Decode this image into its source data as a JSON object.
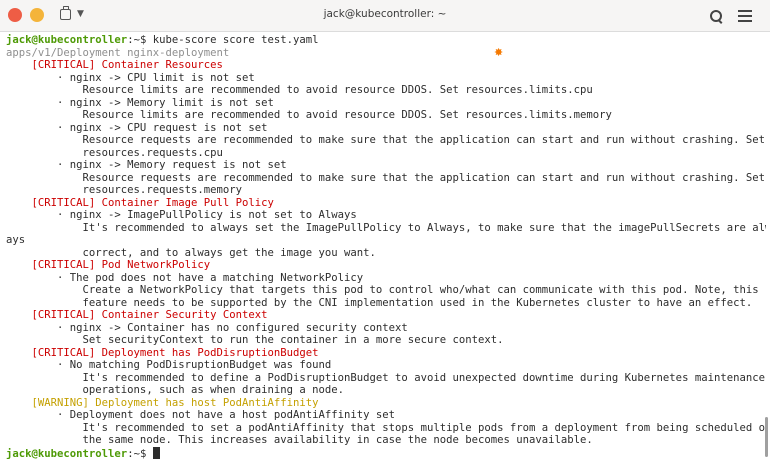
{
  "window": {
    "title": "jack@kubecontroller: ~",
    "icons": {
      "close": "close-icon",
      "minimize": "minimize-icon",
      "new_tab": "new-tab-icon",
      "tab_menu": "chevron-down-icon",
      "search": "search-icon",
      "menu": "hamburger-menu-icon"
    },
    "colors": {
      "close": "#ee5d45",
      "minimize": "#f4b43a",
      "prompt_user": "#4e9a06",
      "critical": "#cc0000",
      "warning": "#c4a000",
      "text": "#2d2d2d"
    }
  },
  "terminal": {
    "prompt_user": "jack@kubecontroller",
    "prompt_path": ":~$ ",
    "command": "kube-score score test.yaml",
    "lines": [
      {
        "style": "prompt",
        "text": "kube-score score test.yaml"
      },
      {
        "style": "kind",
        "text": "apps/v1/Deployment nginx-deployment"
      },
      {
        "style": "crit",
        "text": "    [CRITICAL] Container Resources"
      },
      {
        "style": "plain",
        "text": "        · nginx -> CPU limit is not set"
      },
      {
        "style": "plain",
        "text": "            Resource limits are recommended to avoid resource DDOS. Set resources.limits.cpu"
      },
      {
        "style": "plain",
        "text": "        · nginx -> Memory limit is not set"
      },
      {
        "style": "plain",
        "text": "            Resource limits are recommended to avoid resource DDOS. Set resources.limits.memory"
      },
      {
        "style": "plain",
        "text": "        · nginx -> CPU request is not set"
      },
      {
        "style": "plain",
        "text": "            Resource requests are recommended to make sure that the application can start and run without crashing. Set"
      },
      {
        "style": "plain",
        "text": "            resources.requests.cpu"
      },
      {
        "style": "plain",
        "text": "        · nginx -> Memory request is not set"
      },
      {
        "style": "plain",
        "text": "            Resource requests are recommended to make sure that the application can start and run without crashing. Set"
      },
      {
        "style": "plain",
        "text": "            resources.requests.memory"
      },
      {
        "style": "crit",
        "text": "    [CRITICAL] Container Image Pull Policy"
      },
      {
        "style": "plain",
        "text": "        · nginx -> ImagePullPolicy is not set to Always"
      },
      {
        "style": "plain",
        "text": "            It's recommended to always set the ImagePullPolicy to Always, to make sure that the imagePullSecrets are alw"
      },
      {
        "style": "plain",
        "text": "ays"
      },
      {
        "style": "plain",
        "text": "            correct, and to always get the image you want."
      },
      {
        "style": "crit",
        "text": "    [CRITICAL] Pod NetworkPolicy"
      },
      {
        "style": "plain",
        "text": "        · The pod does not have a matching NetworkPolicy"
      },
      {
        "style": "plain",
        "text": "            Create a NetworkPolicy that targets this pod to control who/what can communicate with this pod. Note, this"
      },
      {
        "style": "plain",
        "text": "            feature needs to be supported by the CNI implementation used in the Kubernetes cluster to have an effect."
      },
      {
        "style": "crit",
        "text": "    [CRITICAL] Container Security Context"
      },
      {
        "style": "plain",
        "text": "        · nginx -> Container has no configured security context"
      },
      {
        "style": "plain",
        "text": "            Set securityContext to run the container in a more secure context."
      },
      {
        "style": "crit",
        "text": "    [CRITICAL] Deployment has PodDisruptionBudget"
      },
      {
        "style": "plain",
        "text": "        · No matching PodDisruptionBudget was found"
      },
      {
        "style": "plain",
        "text": "            It's recommended to define a PodDisruptionBudget to avoid unexpected downtime during Kubernetes maintenance"
      },
      {
        "style": "plain",
        "text": "            operations, such as when draining a node."
      },
      {
        "style": "warn",
        "text": "    [WARNING] Deployment has host PodAntiAffinity"
      },
      {
        "style": "plain",
        "text": "        · Deployment does not have a host podAntiAffinity set"
      },
      {
        "style": "plain",
        "text": "            It's recommended to set a podAntiAffinity that stops multiple pods from a deployment from being scheduled on"
      },
      {
        "style": "plain",
        "text": "            the same node. This increases availability in case the node becomes unavailable."
      },
      {
        "style": "prompt-empty",
        "text": ""
      }
    ]
  }
}
